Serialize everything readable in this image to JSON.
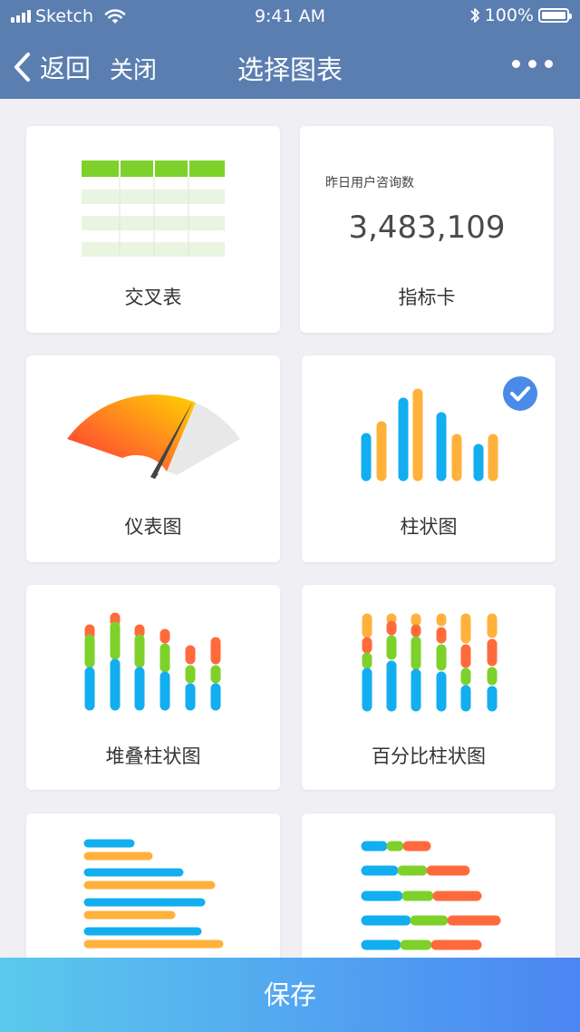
{
  "status_bar": {
    "carrier": "Sketch",
    "time": "9:41 AM",
    "battery": "100%"
  },
  "nav": {
    "back_label": "返回",
    "close_label": "关闭",
    "title": "选择图表"
  },
  "charts": [
    {
      "label": "交叉表",
      "icon": "cross-table-icon"
    },
    {
      "label": "指标卡",
      "icon": "metric-card",
      "metric_title": "昨日用户咨询数",
      "metric_value": "3,483,109"
    },
    {
      "label": "仪表图",
      "icon": "gauge-icon"
    },
    {
      "label": "柱状图",
      "icon": "bar-chart-icon",
      "selected": true
    },
    {
      "label": "堆叠柱状图",
      "icon": "stacked-bar-chart-icon"
    },
    {
      "label": "百分比柱状图",
      "icon": "percent-bar-chart-icon"
    },
    {
      "label": "",
      "icon": "horizontal-bar-chart-icon"
    },
    {
      "label": "",
      "icon": "stacked-horizontal-bar-chart-icon"
    }
  ],
  "save_label": "保存",
  "colors": {
    "header": "#5a7eb0",
    "blue": "#12aef0",
    "orange": "#ffb13b",
    "green": "#7ed12a",
    "red": "#ff6a3d",
    "check": "#4a8ae8"
  }
}
